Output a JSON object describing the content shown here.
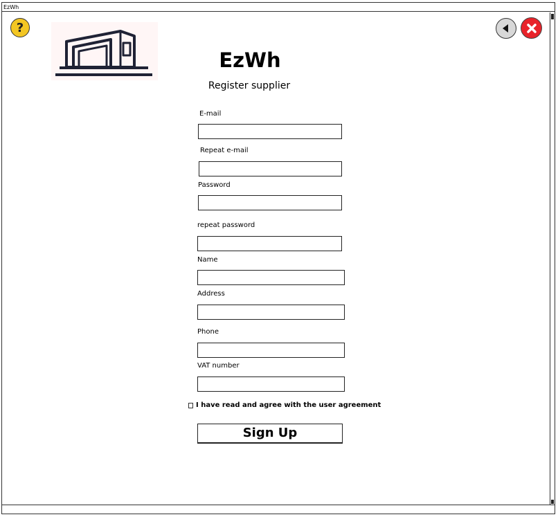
{
  "window": {
    "title": "EzWh"
  },
  "header": {
    "help_icon_glyph": "?",
    "app_title": "EzWh",
    "subtitle": "Register supplier"
  },
  "form": {
    "fields": [
      {
        "label": "E-mail",
        "value": ""
      },
      {
        "label": "Repeat e-mail",
        "value": ""
      },
      {
        "label": "Password",
        "value": ""
      },
      {
        "label": "repeat password",
        "value": ""
      },
      {
        "label": "Name",
        "value": ""
      },
      {
        "label": "Address",
        "value": ""
      },
      {
        "label": "Phone",
        "value": ""
      },
      {
        "label": "VAT number",
        "value": ""
      }
    ],
    "agreement_label": "I have read and agree with the user agreement",
    "agreement_checked": false,
    "submit_label": "Sign Up"
  },
  "colors": {
    "help_button": "#f3c623",
    "close_button": "#e8232a",
    "back_button": "#d8d8d8"
  }
}
